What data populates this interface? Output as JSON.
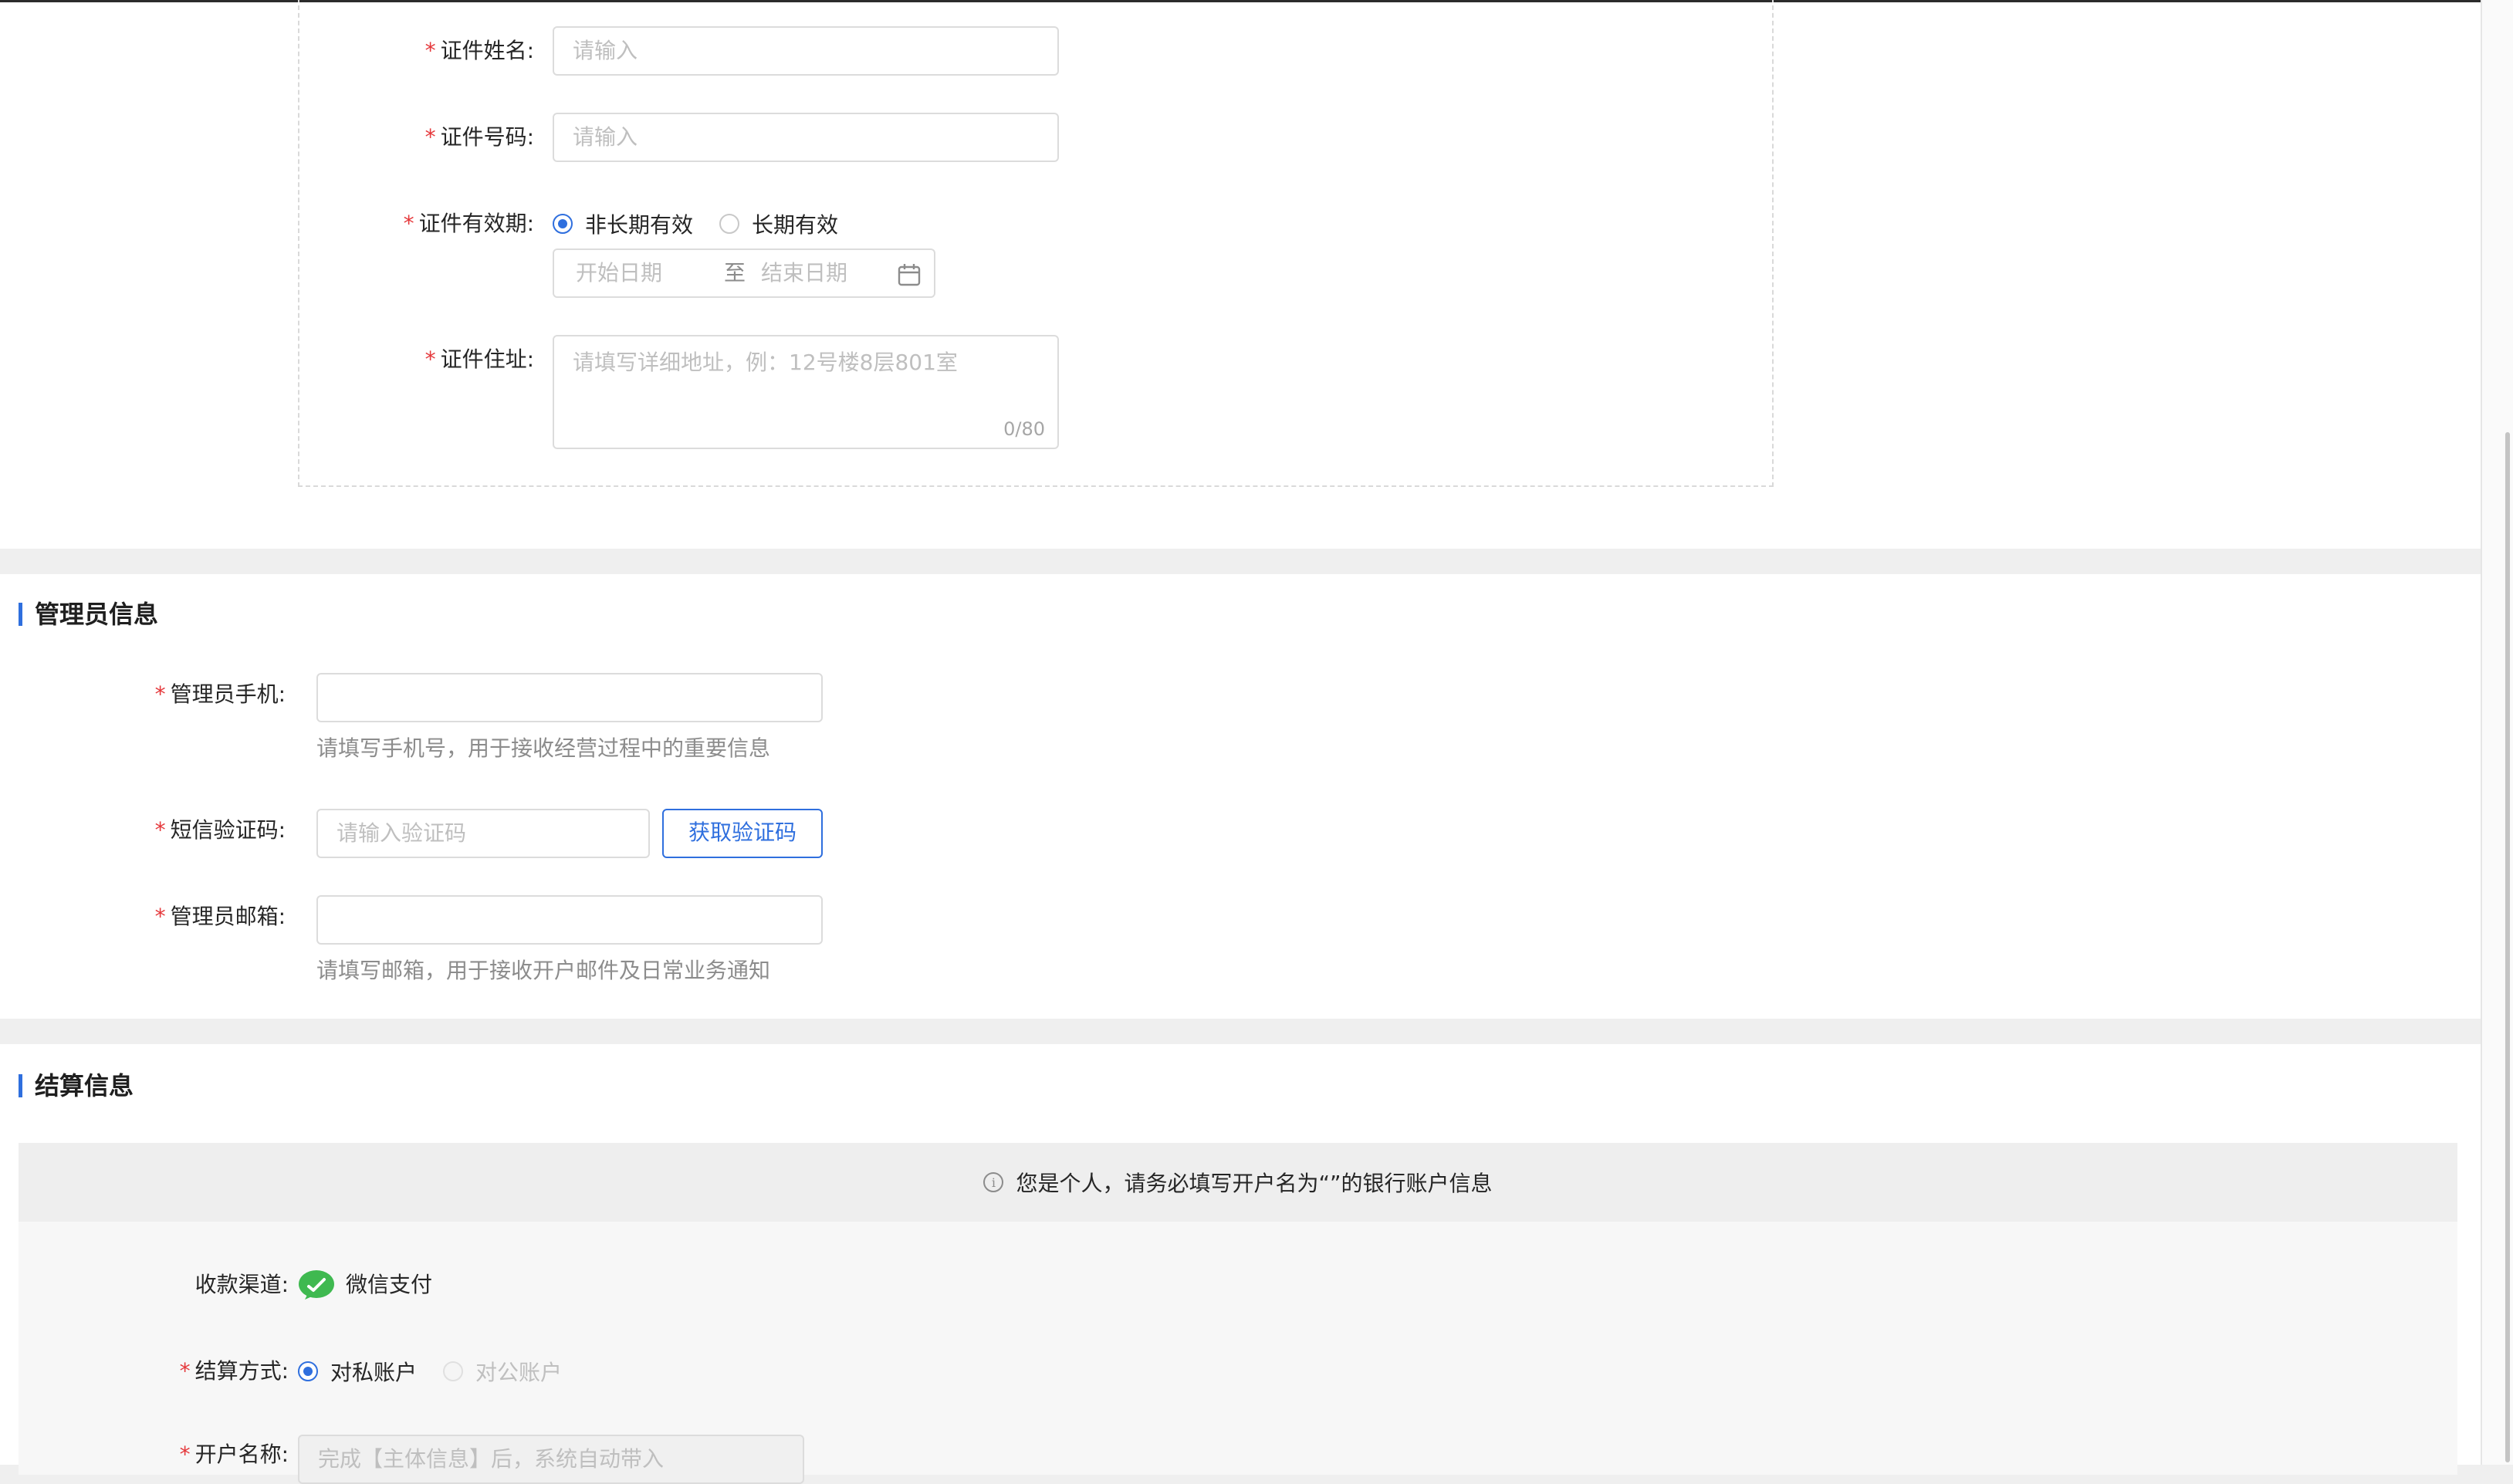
{
  "identity": {
    "name_label": "证件姓名:",
    "name_placeholder": "请输入",
    "number_label": "证件号码:",
    "number_placeholder": "请输入",
    "validity_label": "证件有效期:",
    "validity_options": [
      "非长期有效",
      "长期有效"
    ],
    "validity_selected": "非长期有效",
    "start_date_placeholder": "开始日期",
    "range_separator": "至",
    "end_date_placeholder": "结束日期",
    "address_label": "证件住址:",
    "address_placeholder": "请填写详细地址，例：12号楼8层801室",
    "address_counter": "0/80"
  },
  "admin": {
    "title": "管理员信息",
    "phone_label": "管理员手机:",
    "phone_value": "",
    "phone_hint": "请填写手机号，用于接收经营过程中的重要信息",
    "sms_label": "短信验证码:",
    "sms_placeholder": "请输入验证码",
    "sms_button": "获取验证码",
    "email_label": "管理员邮箱:",
    "email_value": "",
    "email_hint": "请填写邮箱，用于接收开户邮件及日常业务通知"
  },
  "settlement": {
    "title": "结算信息",
    "notice": "您是个人，请务必填写开户名为“”的银行账户信息",
    "channel_label": "收款渠道:",
    "channel_value": "微信支付",
    "method_label": "结算方式:",
    "method_options": [
      "对私账户",
      "对公账户"
    ],
    "method_selected": "对私账户",
    "account_name_label": "开户名称:",
    "account_name_placeholder": "完成【主体信息】后，系统自动带入"
  },
  "colors": {
    "accent": "#2f6fde",
    "required": "#e5383b",
    "wechat_green": "#3fb950"
  }
}
